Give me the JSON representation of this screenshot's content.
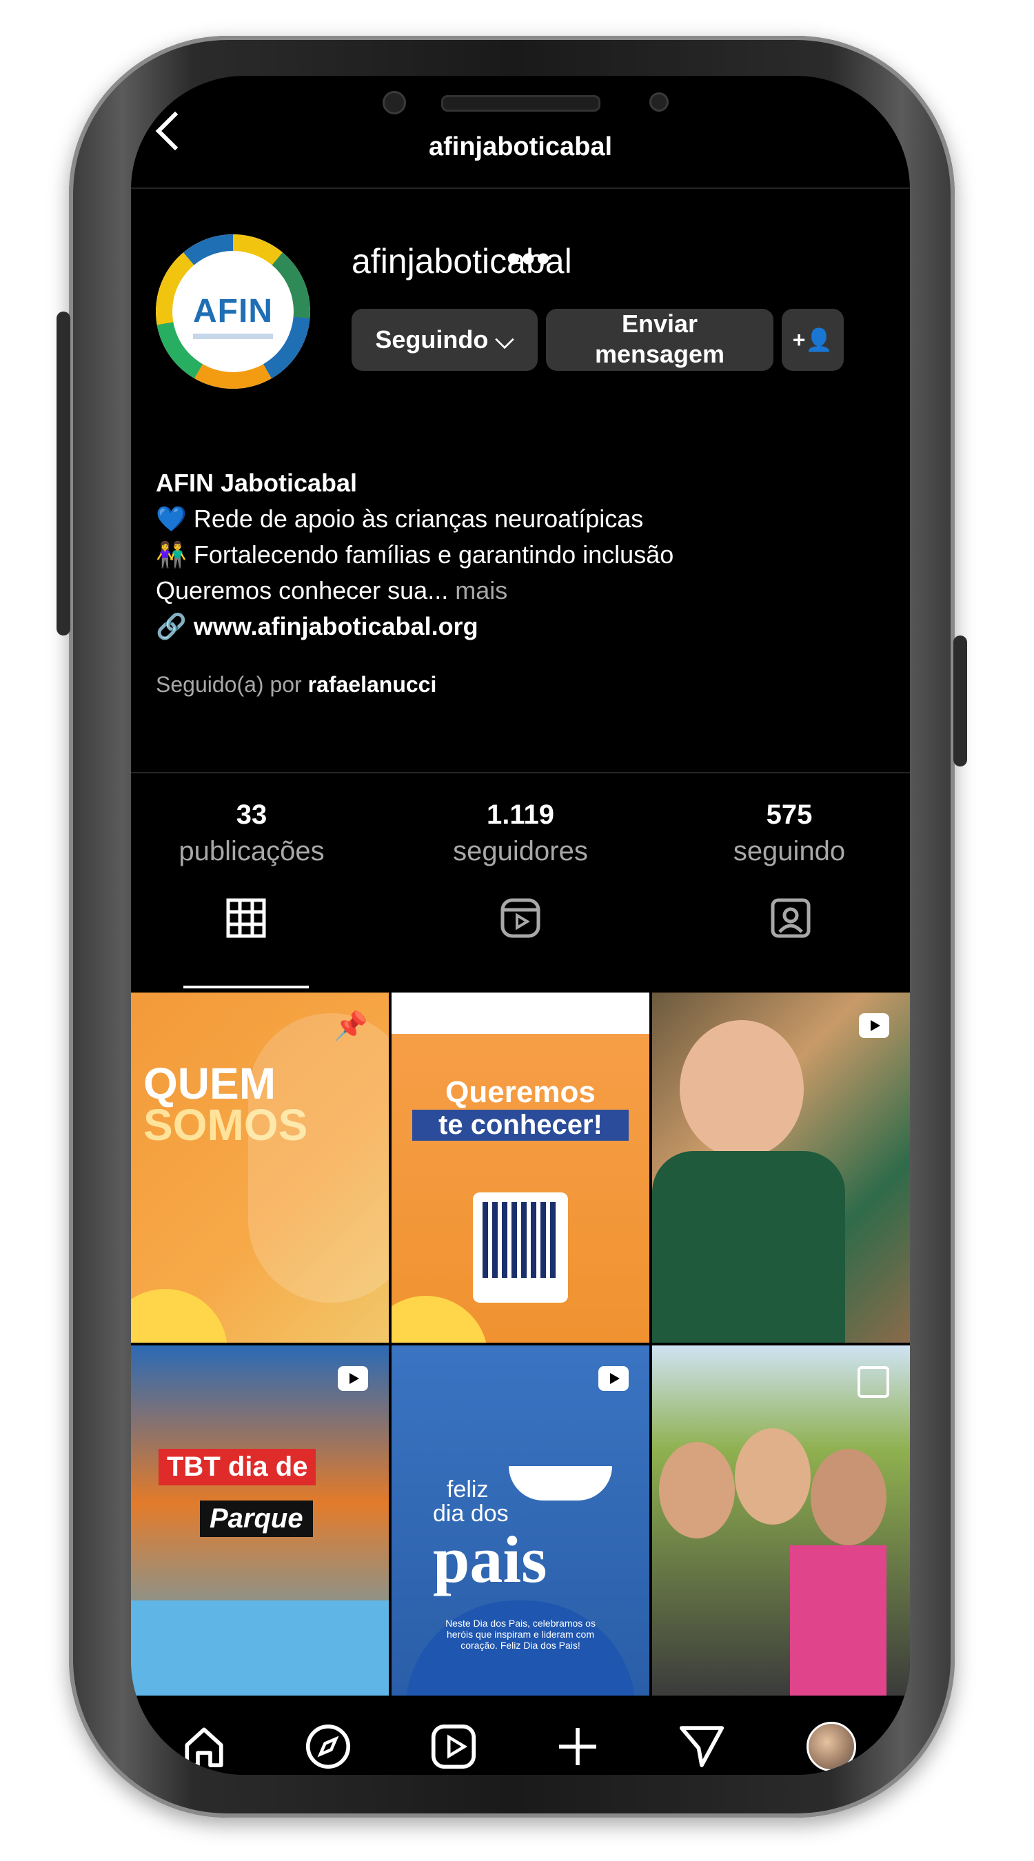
{
  "header": {
    "title": "afinjaboticabal"
  },
  "profile": {
    "username": "afinjaboticabal",
    "avatar_logo": "AFIN",
    "buttons": {
      "following": "Seguindo ⌵",
      "message_line1": "Enviar",
      "message_line2": "mensagem",
      "add_user": "+👤"
    },
    "bio": {
      "name": "AFIN Jaboticabal",
      "line1": "💙 Rede de apoio às crianças neuroatípicas",
      "line2": "👫 Fortalecendo famílias e garantindo inclusão",
      "line3": "Queremos conhecer sua...",
      "more": "mais",
      "link": "www.afinjaboticabal.org",
      "followed_by_prefix": "Seguido(a) por",
      "followed_by_user": "rafaelanucci"
    },
    "stats": [
      {
        "value": "33",
        "label": "publicações"
      },
      {
        "value": "1.119",
        "label": "seguidores"
      },
      {
        "value": "575",
        "label": "seguindo"
      }
    ]
  },
  "tabs": [
    {
      "icon": "grid-icon",
      "active": true
    },
    {
      "icon": "reels-icon",
      "active": false
    },
    {
      "icon": "tagged-icon",
      "active": false
    }
  ],
  "posts": [
    {
      "id": "quem-somos",
      "title_line1": "QUEM",
      "title_line2": "SOMOS",
      "pinned": true
    },
    {
      "id": "queremos",
      "title_line1": "Queremos",
      "title_line2": "te conhecer!",
      "pinned": true
    },
    {
      "id": "girl-eating",
      "reel": true
    },
    {
      "id": "tbt-parque",
      "line1": "TBT dia de",
      "line2": "Parque",
      "reel": true
    },
    {
      "id": "dia-dos-pais",
      "line1": "feliz",
      "line2": "dia dos",
      "line3": "pais",
      "reel": true,
      "small": "Neste Dia dos Pais, celebramos os heróis que inspiram e lideram com coração. Feliz Dia dos Pais!"
    },
    {
      "id": "group-photo",
      "multi": true
    }
  ],
  "nav": [
    "home-icon",
    "explore-icon",
    "reels-icon",
    "create-icon",
    "direct-icon",
    "profile-avatar"
  ],
  "colors": {
    "background": "#000000",
    "button": "#363636",
    "muted": "#a8a8a8",
    "accent_orange": "#f39a3a",
    "accent_blue": "#2a5ea8"
  }
}
